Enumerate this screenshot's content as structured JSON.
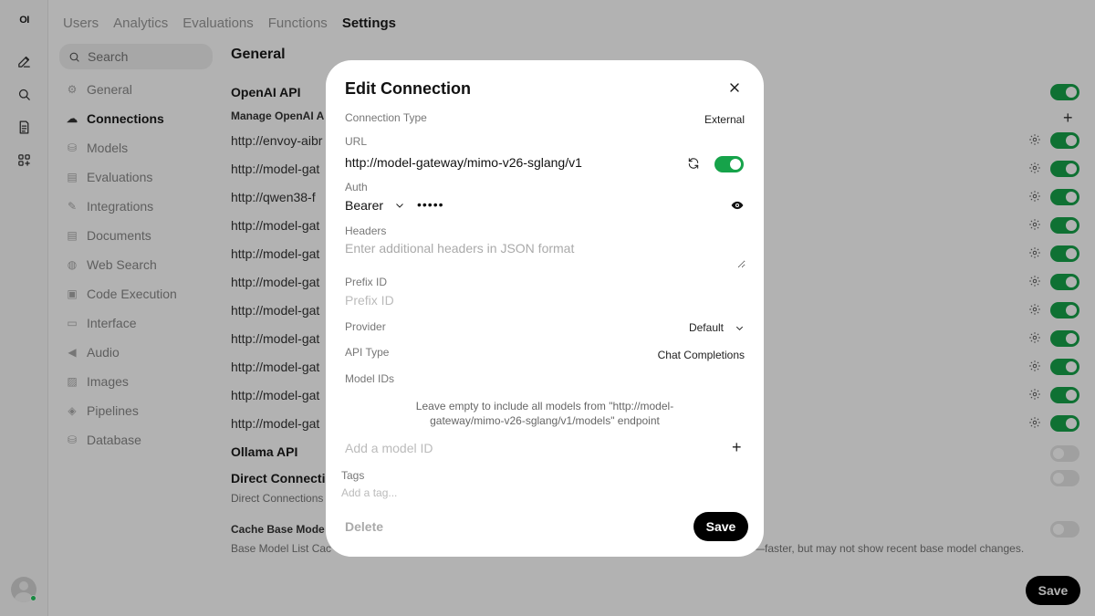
{
  "rail": {
    "logo": "OI",
    "buttons": [
      "new-chat",
      "search",
      "notes",
      "workspace"
    ]
  },
  "tabs": [
    {
      "label": "Users",
      "active": false
    },
    {
      "label": "Analytics",
      "active": false
    },
    {
      "label": "Evaluations",
      "active": false
    },
    {
      "label": "Functions",
      "active": false
    },
    {
      "label": "Settings",
      "active": true
    }
  ],
  "search": {
    "placeholder": "Search"
  },
  "nav": [
    {
      "label": "General",
      "icon": "gear-icon"
    },
    {
      "label": "Connections",
      "icon": "cloud-icon",
      "active": true
    },
    {
      "label": "Models",
      "icon": "cube-icon"
    },
    {
      "label": "Evaluations",
      "icon": "document-icon"
    },
    {
      "label": "Integrations",
      "icon": "wrench-icon"
    },
    {
      "label": "Documents",
      "icon": "document-icon"
    },
    {
      "label": "Web Search",
      "icon": "globe-icon"
    },
    {
      "label": "Code Execution",
      "icon": "terminal-icon"
    },
    {
      "label": "Interface",
      "icon": "monitor-icon"
    },
    {
      "label": "Audio",
      "icon": "speaker-icon"
    },
    {
      "label": "Images",
      "icon": "image-icon"
    },
    {
      "label": "Pipelines",
      "icon": "layers-icon"
    },
    {
      "label": "Database",
      "icon": "database-icon"
    }
  ],
  "main": {
    "title": "General",
    "openai_title": "OpenAI API",
    "manage_label": "Manage OpenAI A",
    "connections": [
      "http://envoy-aibr",
      "http://model-gat",
      "http://qwen38-f",
      "http://model-gat",
      "http://model-gat",
      "http://model-gat",
      "http://model-gat",
      "http://model-gat",
      "http://model-gat",
      "http://model-gat",
      "http://model-gat"
    ],
    "ollama_title": "Ollama API",
    "direct_title": "Direct Connecti",
    "direct_note": "Direct Connections",
    "cache_title": "Cache Base Mode",
    "cache_note_left": "Base Model List Cac",
    "cache_note_right": "—faster, but may not show recent base model changes.",
    "save_label": "Save"
  },
  "modal": {
    "title": "Edit Connection",
    "connection_type_label": "Connection Type",
    "connection_type_value": "External",
    "url_label": "URL",
    "url_value": "http://model-gateway/mimo-v26-sglang/v1",
    "auth_label": "Auth",
    "auth_type": "Bearer",
    "auth_key": "•••••",
    "headers_label": "Headers",
    "headers_placeholder": "Enter additional headers in JSON format",
    "prefix_label": "Prefix ID",
    "prefix_placeholder": "Prefix ID",
    "provider_label": "Provider",
    "provider_value": "Default",
    "api_type_label": "API Type",
    "api_type_value": "Chat Completions",
    "model_ids_label": "Model IDs",
    "model_ids_help_line1": "Leave empty to include all models from \"http://model-",
    "model_ids_help_line2": "gateway/mimo-v26-sglang/v1/models\" endpoint",
    "add_model_placeholder": "Add a model ID",
    "tags_label": "Tags",
    "tags_placeholder": "Add a tag...",
    "delete_label": "Delete",
    "save_label": "Save"
  },
  "colors": {
    "accent": "#16a34a",
    "overlay": "rgba(0,0,0,0.30)"
  }
}
